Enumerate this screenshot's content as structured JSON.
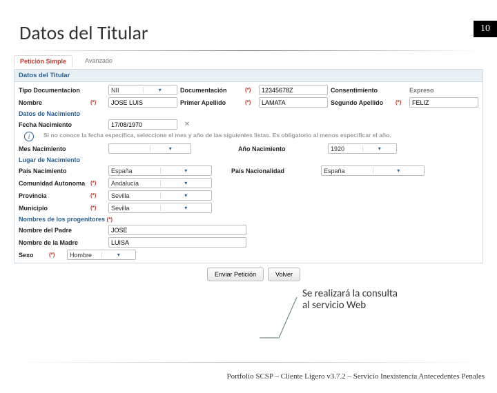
{
  "page_number": "10",
  "title": "Datos del Titular",
  "tabs": {
    "simple": "Petición Simple",
    "advanced": "Avanzado"
  },
  "panel": {
    "header": "Datos del Titular",
    "tipo_doc_label": "Tipo Documentacion",
    "tipo_doc_value": "NII",
    "documentacion_label": "Documentación",
    "documentacion_value": "12345678Z",
    "consentimiento_label": "Consentimiento",
    "consentimiento_value": "Expreso",
    "nombre_label": "Nombre",
    "nombre_value": "JOSE LUIS",
    "primer_apellido_label": "Primer Apellido",
    "primer_apellido_value": "LAMATA",
    "segundo_apellido_label": "Segundo Apellido",
    "segundo_apellido_value": "FELIZ",
    "datos_nac_header": "Datos de Nacimiento",
    "fecha_nac_label": "Fecha Nacimiento",
    "fecha_nac_value": "17/08/1970",
    "info_text": "Si no conoce la fecha específica, seleccione el mes y año de las siguientes listas. Es obligatorio al menos especificar el año.",
    "mes_nac_label": "Mes Nacimiento",
    "mes_nac_value": "",
    "ano_nac_label": "Año Nacimiento",
    "ano_nac_value": "1920",
    "lugar_nac_header": "Lugar de Nacimiento",
    "pais_nac_label": "País Nacimiento",
    "pais_nac_value": "España",
    "pais_nacion_label": "País Nacionalidad",
    "pais_nacion_value": "España",
    "comunidad_label": "Comunidad Autonoma",
    "comunidad_value": "Andalucía",
    "provincia_label": "Provincia",
    "provincia_value": "Sevilla",
    "municipio_label": "Municipio",
    "municipio_value": "Sevilla",
    "progenitores_header": "Nombres de los progenitores",
    "padre_label": "Nombre del Padre",
    "padre_value": "JOSE",
    "madre_label": "Nombre de la Madre",
    "madre_value": "LUISA",
    "sexo_label": "Sexo",
    "sexo_value": "Hombre",
    "req": "(*)"
  },
  "buttons": {
    "send": "Enviar Petición",
    "back": "Volver"
  },
  "callout": "Se realizará la consulta al servicio Web",
  "footer": "Portfolio SCSP – Cliente Ligero v3.7.2 – Servicio Inexistencia Antecedentes Penales"
}
